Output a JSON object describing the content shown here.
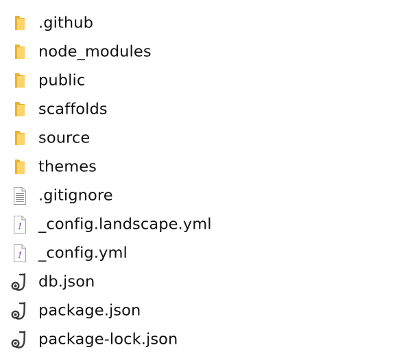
{
  "explorer": {
    "items": [
      {
        "name": ".github",
        "type": "folder-icon"
      },
      {
        "name": "node_modules",
        "type": "folder-icon"
      },
      {
        "name": "public",
        "type": "folder-icon"
      },
      {
        "name": "scaffolds",
        "type": "folder-icon"
      },
      {
        "name": "source",
        "type": "folder-icon"
      },
      {
        "name": "themes",
        "type": "folder-icon"
      },
      {
        "name": ".gitignore",
        "type": "text-file-icon"
      },
      {
        "name": "_config.landscape.yml",
        "type": "yaml-file-icon"
      },
      {
        "name": "_config.yml",
        "type": "yaml-file-icon"
      },
      {
        "name": "db.json",
        "type": "json-file-icon"
      },
      {
        "name": "package.json",
        "type": "json-file-icon"
      },
      {
        "name": "package-lock.json",
        "type": "json-file-icon"
      }
    ]
  },
  "colors": {
    "folder_back": "#e9b22c",
    "folder_front": "#fcd36c",
    "doc_border": "#9a9a9a",
    "yaml_mark": "#8a4fc8",
    "json_icon": "#3a3a3a"
  }
}
